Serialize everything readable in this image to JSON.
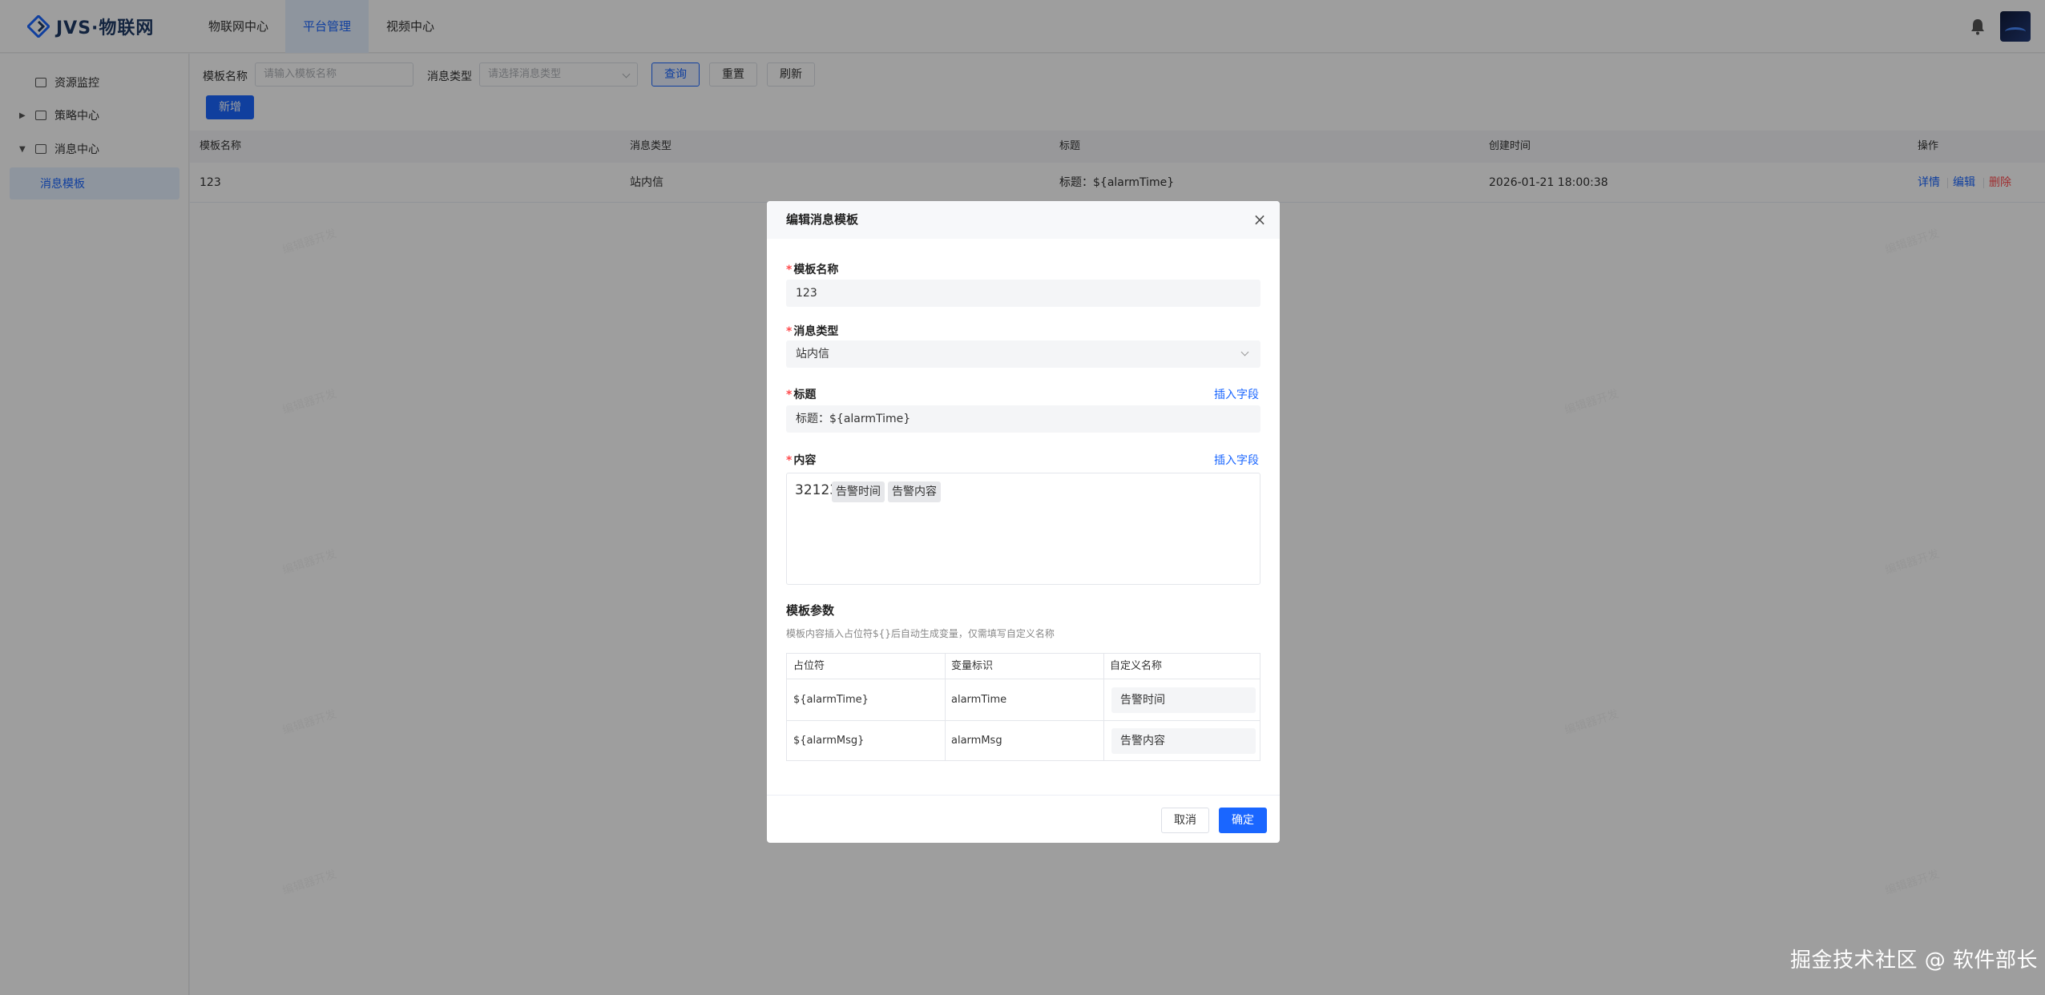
{
  "header": {
    "logo_text": "JVS·物联网",
    "tabs": [
      {
        "label": "物联网中心"
      },
      {
        "label": "平台管理"
      },
      {
        "label": "视频中心"
      }
    ]
  },
  "sidebar": {
    "items": [
      {
        "label": "资源监控"
      },
      {
        "label": "策略中心"
      },
      {
        "label": "消息中心"
      },
      {
        "label": "消息模板"
      }
    ]
  },
  "filters": {
    "name_label": "模板名称",
    "name_placeholder": "请输入模板名称",
    "type_label": "消息类型",
    "type_placeholder": "请选择消息类型",
    "query": "查询",
    "reset": "重置",
    "refresh": "刷新",
    "add": "新增"
  },
  "table": {
    "headers": [
      "模板名称",
      "消息类型",
      "标题",
      "创建时间",
      "操作"
    ],
    "rows": [
      {
        "name": "123",
        "type": "站内信",
        "title": "标题：${alarmTime}",
        "created": "2026-01-21 18:00:38",
        "actions": {
          "detail": "详情",
          "edit": "编辑",
          "delete": "删除"
        }
      }
    ]
  },
  "watermark_text": "编辑器开发",
  "footer_mark": "掘金技术社区 @ 软件部长",
  "modal": {
    "title": "编辑消息模板",
    "close": "×",
    "name_label": "模板名称",
    "name_value": "123",
    "type_label": "消息类型",
    "type_value": "站内信",
    "title_label": "标题",
    "insert_field": "插入字段",
    "title_value": "标题：${alarmTime}",
    "content_label": "内容",
    "content_text": "32123",
    "content_chips": [
      "告警时间",
      "告警内容"
    ],
    "params_title": "模板参数",
    "params_desc": "模板内容插入占位符${}后自动生成变量，仅需填写自定义名称",
    "params_headers": [
      "占位符",
      "变量标识",
      "自定义名称"
    ],
    "params_rows": [
      {
        "placeholder": "${alarmTime}",
        "var": "alarmTime",
        "custom": "告警时间"
      },
      {
        "placeholder": "${alarmMsg}",
        "var": "alarmMsg",
        "custom": "告警内容"
      }
    ],
    "cancel": "取消",
    "confirm": "确定"
  },
  "colors": {
    "primary": "#1a66ff",
    "danger": "#ff4d4f",
    "required": "#ff4d4f"
  }
}
